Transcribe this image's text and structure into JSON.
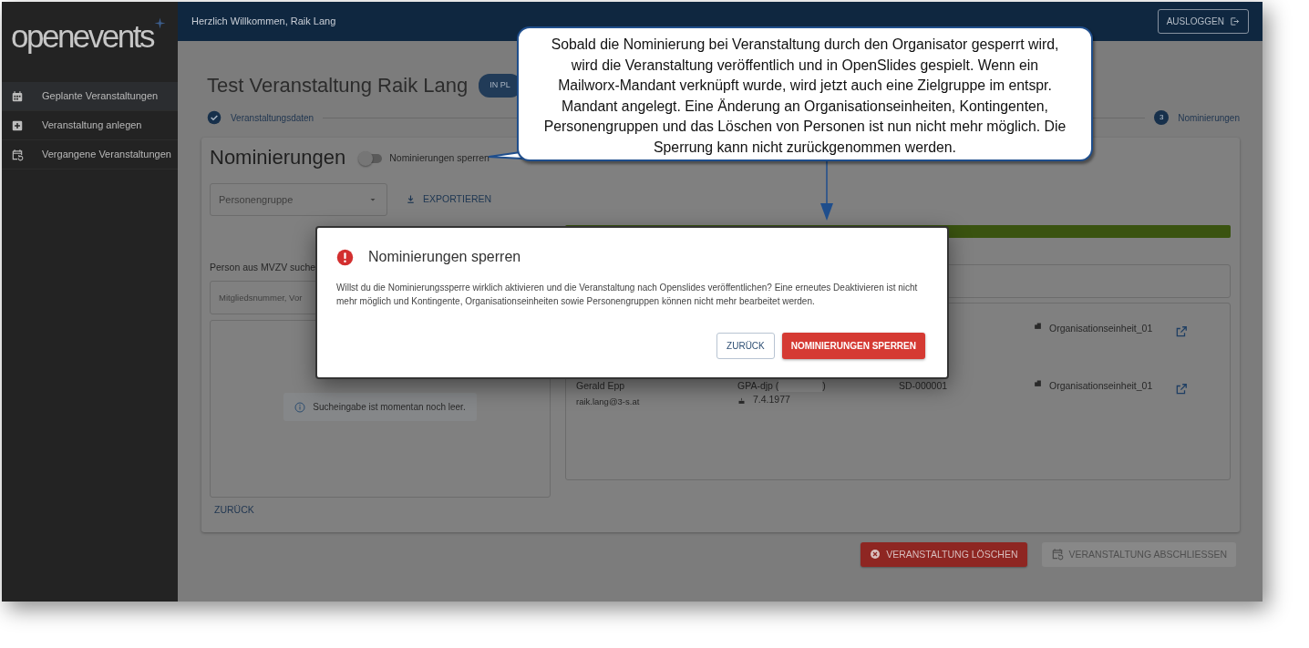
{
  "sidebar": {
    "logo": "openevents",
    "items": [
      {
        "label": "Geplante Veranstaltungen",
        "selected": true
      },
      {
        "label": "Veranstaltung anlegen",
        "selected": false
      },
      {
        "label": "Vergangene Veranstaltungen",
        "selected": false
      }
    ]
  },
  "header": {
    "greeting": "Herzlich Willkommen, Raik Lang",
    "logout": "AUSLOGGEN"
  },
  "event": {
    "title": "Test Veranstaltung Raik Lang",
    "status_badge": "IN PL"
  },
  "steps": [
    {
      "label": "Veranstaltungsdaten",
      "completed": true
    },
    {
      "label": "Nominierungen",
      "number": "3",
      "completed": false
    }
  ],
  "nominations": {
    "title": "Nominierungen",
    "lock_toggle": {
      "label": "Nominierungen sperren",
      "on": false
    },
    "group_select": {
      "placeholder": "Personengruppe"
    },
    "export": "EXPORTIEREN",
    "progress": {
      "level": 1
    },
    "search_label": "Person aus MVZV suche",
    "search_field": {
      "placeholder": "Mitgliedsnummer, Vor"
    },
    "empty_notice": "Sucheingabe ist momentan noch leer.",
    "rows": [
      {
        "org_unit": "Organisationseinheit_01"
      },
      {
        "name": "Gerald Epp",
        "email": "raik.lang@3-s.at",
        "union": "GPA-djp (",
        "union_end": ")",
        "birthdate": "7.4.1977",
        "number": "SD-000001",
        "org_unit": "Organisationseinheit_01"
      }
    ],
    "back": "ZURÜCK"
  },
  "actions": [
    {
      "label": "VERANSTALTUNG LÖSCHEN",
      "kind": "danger",
      "disabled": false
    },
    {
      "label": "VERANSTALTUNG ABSCHLIESSEN",
      "kind": "finish",
      "disabled": true
    }
  ],
  "dialog": {
    "title": "Nominierungen sperren",
    "message": "Willst du die Nominierungssperre wirklich aktivieren und die Veranstaltung nach Openslides veröffentlichen? Eine erneutes Deaktivieren ist nicht mehr möglich und Kontingente, Organisationseinheiten sowie Personengruppen können nicht mehr bearbeitet werden.",
    "buttons": [
      {
        "label": "ZURÜCK",
        "kind": "secondary"
      },
      {
        "label": "NOMINIERUNGEN SPERREN",
        "kind": "danger"
      }
    ]
  },
  "callout": {
    "text": "Sobald die Nominierung bei Veranstaltung durch den Organisator gesperrt wird, wird die Veranstaltung veröffentlich und in OpenSlides gespielt. Wenn ein Mailworx-Mandant verknüpft wurde, wird jetzt auch eine Zielgruppe im entspr. Mandant angelegt. Eine Änderung an Organisationseinheiten, Kontingenten,  Personengruppen und das Löschen von Personen ist nun nicht mehr möglich. Die Sperrung kann nicht zurückgenommen werden."
  }
}
